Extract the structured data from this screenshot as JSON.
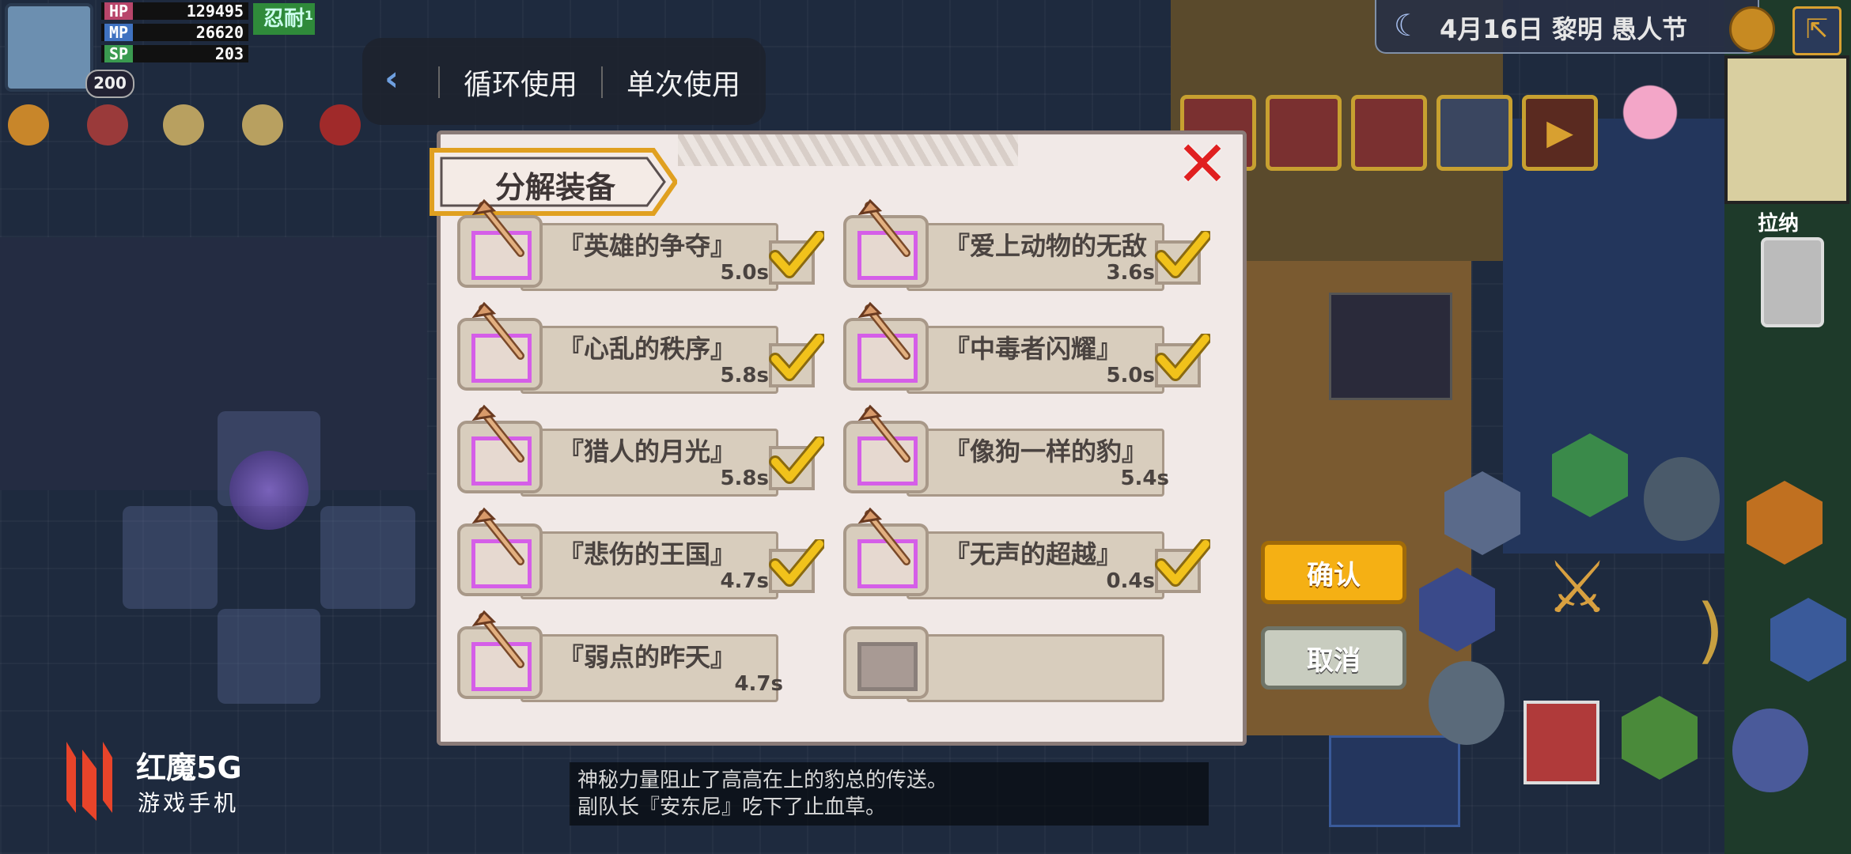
{
  "hud": {
    "hp_label": "HP",
    "hp_value": "129495",
    "mp_label": "MP",
    "mp_value": "26620",
    "sp_label": "SP",
    "sp_value": "203",
    "level": "200",
    "status_badge": "忍耐",
    "status_badge_count": "1"
  },
  "menu": {
    "back_icon": "chevron-left-icon",
    "loop_use": "循环使用",
    "single_use": "单次使用"
  },
  "topbar": {
    "date_text": "4月16日 黎明 愚人节",
    "moon_icon": "crescent-moon-icon",
    "globe_icon": "globe-icon",
    "exit_icon": "exit-icon"
  },
  "side": {
    "pull_label": "拉纳"
  },
  "panel": {
    "title": "分解装备",
    "close_icon": "red-x-close-icon",
    "items": [
      {
        "name": "『英雄的争夺』",
        "time": "5.0s",
        "checked": true
      },
      {
        "name": "『爱上动物的无敌",
        "time": "3.6s",
        "checked": true
      },
      {
        "name": "『心乱的秩序』",
        "time": "5.8s",
        "checked": true
      },
      {
        "name": "『中毒者闪耀』",
        "time": "5.0s",
        "checked": true
      },
      {
        "name": "『猎人的月光』",
        "time": "5.8s",
        "checked": true
      },
      {
        "name": "『像狗一样的豹』",
        "time": "5.4s",
        "checked": false
      },
      {
        "name": "『悲伤的王国』",
        "time": "4.7s",
        "checked": true
      },
      {
        "name": "『无声的超越』",
        "time": "0.4s",
        "checked": true
      },
      {
        "name": "『弱点的昨天』",
        "time": "4.7s",
        "checked": false
      },
      {
        "name": "",
        "time": "",
        "checked": false,
        "empty": true
      }
    ],
    "confirm": "确认",
    "cancel": "取消"
  },
  "log": {
    "line1": "神秘力量阻止了高高在上的豹总的传送。",
    "line2": "副队长『安东尼』吃下了止血草。"
  },
  "watermark": {
    "brand": "红魔5G",
    "sub": "游戏手机"
  },
  "colors": {
    "confirm_bg": "#f5b014",
    "cancel_bg": "#c8ccbf",
    "item_frame": "#d55ee8",
    "check": "#f1c21b"
  }
}
